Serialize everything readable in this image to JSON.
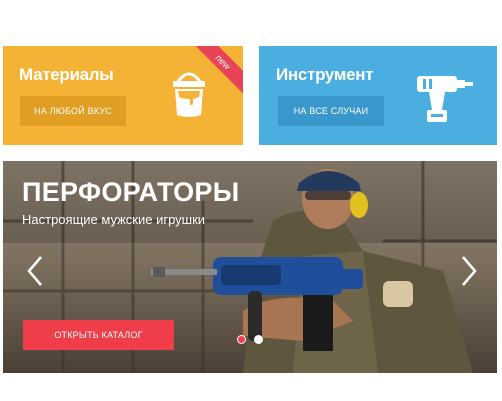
{
  "cards": {
    "materials": {
      "title": "Материалы",
      "button_label": "На любой вкус",
      "ribbon": "new",
      "icon": "paint-bucket-icon"
    },
    "tools": {
      "title": "Инструмент",
      "button_label": "На все случаи",
      "icon": "drill-icon"
    }
  },
  "slider": {
    "title": "ПЕРФОРАТОРЫ",
    "subtitle": "Настроящие мужские игрушки",
    "cta_label": "Открыть каталог",
    "active_slide": 1,
    "slide_count": 2
  },
  "colors": {
    "materials": "#f5b335",
    "tools": "#4aaee0",
    "accent": "#ef3e4a"
  }
}
